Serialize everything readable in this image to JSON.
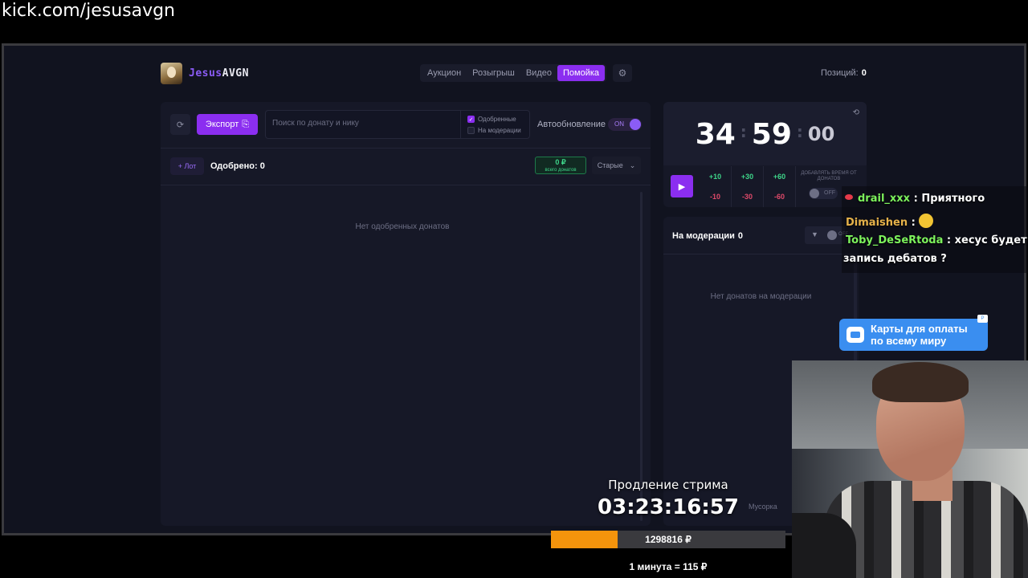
{
  "browser": {
    "url": "kick.com/jesusavgn"
  },
  "header": {
    "logo_part1": "Jesus",
    "logo_part2": "AVGN",
    "tabs": [
      {
        "label": "Аукцион",
        "active": false
      },
      {
        "label": "Розыгрыш",
        "active": false
      },
      {
        "label": "Видео",
        "active": false
      },
      {
        "label": "Помойка",
        "active": true
      }
    ],
    "settings_icon": "gear-icon",
    "positions_label": "Позиций:",
    "positions_value": "0"
  },
  "toolbar": {
    "refresh_icon": "refresh-icon",
    "export_label": "Экспорт",
    "search_placeholder": "Поиск по донату и нику",
    "filter_approved": "Одобренные",
    "filter_approved_checked": true,
    "filter_moderation": "На модерации",
    "filter_moderation_checked": false,
    "autoupdate_label": "Автообновление",
    "autoupdate_state": "ON"
  },
  "approved": {
    "lot_button": "+ Лот",
    "label": "Одобрено: 0",
    "sum_value": "0 ₽",
    "sum_label": "всего донатов",
    "sort_label": "Старые",
    "empty_text": "Нет одобренных донатов"
  },
  "timer": {
    "minutes": "34",
    "seconds": "59",
    "centis": "00",
    "plus": [
      "+10",
      "+30",
      "+60"
    ],
    "minus": [
      "-10",
      "-30",
      "-60"
    ],
    "donate_time_label": "ДОБАВЛЯТЬ ВРЕМЯ ОТ ДОНАТОВ",
    "donate_time_state": "OFF"
  },
  "moderation": {
    "label": "На модерации",
    "count": "0",
    "filter_state": "OFF",
    "empty_text": "Нет донатов на модерации",
    "trash_label": "Мусорка"
  },
  "chat": {
    "messages": [
      {
        "user": "drail_xxx",
        "sep": " : ",
        "text": "Приятного"
      },
      {
        "user": "Dimaishen",
        "sep": " : ",
        "text": ""
      },
      {
        "user": "Toby_DeSeRtoda",
        "sep": " : ",
        "text": "хесус будет"
      },
      {
        "user": "",
        "sep": "",
        "text": "запись дебатов ?"
      }
    ]
  },
  "ad": {
    "line1": "Карты для оплаты",
    "line2": "по всему миру",
    "tag": "Р"
  },
  "stream": {
    "title": "Продление стрима",
    "timer": "03:23:16:57",
    "progress_fraction": 0.285,
    "progress_text": "1298816 ₽",
    "rate_text": "1 минута = 115 ₽"
  },
  "colors": {
    "accent": "#8b2ef0",
    "green": "#3ed68a",
    "red": "#e04a6a",
    "progress": "#f5940c"
  }
}
